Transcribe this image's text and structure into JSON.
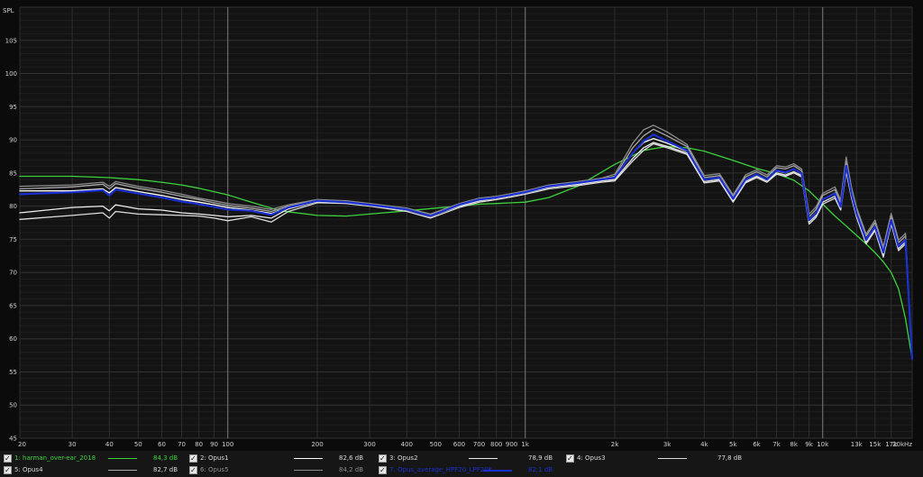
{
  "chart_data": {
    "type": "line",
    "title": "",
    "xlabel": "",
    "ylabel": "SPL",
    "x_scale": "log",
    "xlim": [
      20,
      20000
    ],
    "ylim": [
      45,
      110
    ],
    "grid": true,
    "y_ticks": [
      45,
      50,
      55,
      60,
      65,
      70,
      75,
      80,
      85,
      90,
      95,
      100,
      105
    ],
    "x_ticks": [
      {
        "v": 20,
        "label": "20"
      },
      {
        "v": 30,
        "label": "30"
      },
      {
        "v": 40,
        "label": "40"
      },
      {
        "v": 50,
        "label": "50"
      },
      {
        "v": 60,
        "label": "60"
      },
      {
        "v": 70,
        "label": "70"
      },
      {
        "v": 80,
        "label": "80"
      },
      {
        "v": 90,
        "label": "90"
      },
      {
        "v": 100,
        "label": "100"
      },
      {
        "v": 200,
        "label": "200"
      },
      {
        "v": 300,
        "label": "300"
      },
      {
        "v": 400,
        "label": "400"
      },
      {
        "v": 500,
        "label": "500"
      },
      {
        "v": 600,
        "label": "600"
      },
      {
        "v": 700,
        "label": "700"
      },
      {
        "v": 800,
        "label": "800"
      },
      {
        "v": 900,
        "label": "900"
      },
      {
        "v": 1000,
        "label": "1k"
      },
      {
        "v": 2000,
        "label": "2k"
      },
      {
        "v": 3000,
        "label": "3k"
      },
      {
        "v": 4000,
        "label": "4k"
      },
      {
        "v": 5000,
        "label": "5k"
      },
      {
        "v": 6000,
        "label": "6k"
      },
      {
        "v": 7000,
        "label": "7k"
      },
      {
        "v": 8000,
        "label": "8k"
      },
      {
        "v": 9000,
        "label": "9k"
      },
      {
        "v": 10000,
        "label": "10k"
      },
      {
        "v": 13000,
        "label": "13k"
      },
      {
        "v": 15000,
        "label": "15k"
      },
      {
        "v": 17000,
        "label": "17k"
      },
      {
        "v": 20000,
        "label": "20kHz"
      }
    ],
    "major_x": [
      100,
      1000,
      10000
    ],
    "series": [
      {
        "name": "1: harman_over-ear_2018",
        "color": "#3cd23c",
        "width": 1.3,
        "x": [
          20,
          30,
          40,
          50,
          60,
          70,
          80,
          100,
          120,
          150,
          200,
          250,
          300,
          400,
          500,
          600,
          700,
          800,
          900,
          1000,
          1200,
          1500,
          2000,
          2500,
          3000,
          3500,
          4000,
          5000,
          6000,
          7000,
          8000,
          9000,
          10000,
          11000,
          12000,
          13000,
          14000,
          15000,
          16000,
          17000,
          18000,
          19000,
          20000
        ],
        "y": [
          84.5,
          84.5,
          84.3,
          84.0,
          83.6,
          83.2,
          82.7,
          81.7,
          80.6,
          79.3,
          78.6,
          78.5,
          78.8,
          79.3,
          79.7,
          80.0,
          80.3,
          80.4,
          80.5,
          80.6,
          81.3,
          83.0,
          86.3,
          88.4,
          89.0,
          88.8,
          88.3,
          86.9,
          85.7,
          84.9,
          83.9,
          82.3,
          80.3,
          78.5,
          77.0,
          75.6,
          74.3,
          73.0,
          71.6,
          70.0,
          67.5,
          63.0,
          57.0
        ]
      },
      {
        "name": "2: Opus1",
        "color": "#ffffff",
        "width": 1.3,
        "x": [
          20,
          30,
          38,
          40,
          42,
          50,
          60,
          70,
          80,
          90,
          100,
          120,
          140,
          160,
          200,
          250,
          300,
          400,
          480,
          600,
          700,
          800,
          900,
          1000,
          1200,
          1500,
          1800,
          2000,
          2300,
          2500,
          2700,
          3000,
          3500,
          4000,
          4500,
          5000,
          5500,
          6000,
          6500,
          7000,
          7500,
          8000,
          8500,
          9000,
          9500,
          10000,
          11000,
          11500,
          12000,
          12500,
          13000,
          14000,
          15000,
          16000,
          17000,
          18000,
          19000,
          20000
        ],
        "y": [
          82.3,
          82.3,
          82.6,
          82.0,
          82.8,
          82.2,
          81.6,
          81.0,
          80.6,
          80.2,
          79.8,
          79.4,
          78.9,
          79.8,
          80.7,
          80.6,
          80.2,
          79.5,
          78.4,
          80.2,
          81.0,
          81.3,
          81.7,
          82.1,
          83.0,
          83.5,
          84.0,
          84.3,
          88.0,
          89.6,
          90.2,
          89.5,
          88.3,
          84.0,
          84.2,
          81.0,
          84.0,
          84.8,
          84.0,
          85.3,
          85.0,
          85.6,
          84.8,
          78.0,
          79.0,
          81.0,
          82.0,
          80.0,
          86.0,
          82.0,
          79.0,
          75.0,
          77.0,
          73.0,
          78.0,
          74.0,
          75.0,
          57.0
        ]
      },
      {
        "name": "3: Opus2",
        "color": "#ececec",
        "width": 1.3,
        "x": [
          20,
          30,
          38,
          40,
          42,
          50,
          60,
          70,
          80,
          90,
          100,
          120,
          140,
          160,
          200,
          250,
          300,
          400,
          480,
          600,
          700,
          800,
          900,
          1000,
          1200,
          1500,
          1800,
          2000,
          2300,
          2500,
          2700,
          3000,
          3500,
          4000,
          4500,
          5000,
          5500,
          6000,
          6500,
          7000,
          7500,
          8000,
          8500,
          9000,
          9500,
          10000,
          11000,
          11500,
          12000,
          12500,
          13000,
          14000,
          15000,
          16000,
          17000,
          18000,
          19000,
          20000
        ],
        "y": [
          79.0,
          79.8,
          80.0,
          79.3,
          80.2,
          79.6,
          79.4,
          79.0,
          78.8,
          78.6,
          78.4,
          78.6,
          78.2,
          79.6,
          80.7,
          80.5,
          80.1,
          79.4,
          78.5,
          80.0,
          80.8,
          81.2,
          81.6,
          82.0,
          82.8,
          83.3,
          83.8,
          84.0,
          87.2,
          88.8,
          89.6,
          89.0,
          88.0,
          83.7,
          84.0,
          80.8,
          83.7,
          84.5,
          83.8,
          85.0,
          84.7,
          85.2,
          84.6,
          77.6,
          78.6,
          80.6,
          81.5,
          79.7,
          85.5,
          81.6,
          78.6,
          74.6,
          76.6,
          72.6,
          77.6,
          73.6,
          74.6,
          57.0
        ]
      },
      {
        "name": "4: Opus3",
        "color": "#dcdcdc",
        "width": 1.3,
        "x": [
          20,
          30,
          38,
          40,
          42,
          50,
          60,
          70,
          80,
          90,
          100,
          120,
          140,
          160,
          200,
          250,
          300,
          400,
          480,
          600,
          700,
          800,
          900,
          1000,
          1200,
          1500,
          1800,
          2000,
          2300,
          2500,
          2700,
          3000,
          3500,
          4000,
          4500,
          5000,
          5500,
          6000,
          6500,
          7000,
          7500,
          8000,
          8500,
          9000,
          9500,
          10000,
          11000,
          11500,
          12000,
          12500,
          13000,
          14000,
          15000,
          16000,
          17000,
          18000,
          19000,
          20000
        ],
        "y": [
          78.0,
          78.6,
          79.0,
          78.2,
          79.2,
          78.8,
          78.7,
          78.6,
          78.5,
          78.2,
          77.8,
          78.4,
          77.6,
          79.2,
          80.5,
          80.4,
          80.0,
          79.2,
          78.2,
          79.8,
          80.6,
          81.0,
          81.4,
          81.8,
          82.6,
          83.1,
          83.6,
          83.8,
          86.8,
          88.4,
          89.4,
          88.8,
          87.8,
          83.5,
          83.8,
          80.6,
          83.5,
          84.3,
          83.6,
          84.8,
          84.5,
          85.0,
          84.4,
          77.3,
          78.3,
          80.3,
          81.2,
          79.4,
          85.2,
          81.3,
          78.3,
          74.3,
          76.3,
          72.3,
          77.3,
          73.3,
          74.3,
          57.0
        ]
      },
      {
        "name": "5: Opus4",
        "color": "#a8a8a8",
        "width": 1.3,
        "x": [
          20,
          30,
          38,
          40,
          42,
          50,
          60,
          70,
          80,
          90,
          100,
          120,
          140,
          160,
          200,
          250,
          300,
          400,
          480,
          600,
          700,
          800,
          900,
          1000,
          1200,
          1500,
          1800,
          2000,
          2300,
          2500,
          2700,
          3000,
          3500,
          4000,
          4500,
          5000,
          5500,
          6000,
          6500,
          7000,
          7500,
          8000,
          8500,
          9000,
          9500,
          10000,
          11000,
          11500,
          12000,
          12500,
          13000,
          14000,
          15000,
          16000,
          17000,
          18000,
          19000,
          20000
        ],
        "y": [
          82.6,
          82.9,
          83.3,
          82.6,
          83.4,
          82.7,
          82.1,
          81.5,
          81.0,
          80.5,
          80.1,
          79.7,
          79.2,
          80.0,
          80.9,
          80.7,
          80.3,
          79.6,
          78.6,
          80.3,
          81.1,
          81.4,
          81.8,
          82.2,
          83.1,
          83.6,
          84.1,
          84.5,
          88.8,
          90.6,
          91.6,
          90.6,
          89.0,
          84.3,
          84.6,
          81.4,
          84.4,
          85.2,
          84.4,
          85.8,
          85.6,
          86.1,
          85.3,
          78.4,
          79.5,
          81.6,
          82.5,
          80.5,
          86.8,
          82.5,
          79.5,
          75.5,
          77.5,
          73.6,
          78.5,
          74.5,
          75.5,
          57.0
        ]
      },
      {
        "name": "6: Opus5",
        "color": "#8c8c8c",
        "width": 1.3,
        "x": [
          20,
          30,
          38,
          40,
          42,
          50,
          60,
          70,
          80,
          90,
          100,
          120,
          140,
          160,
          200,
          250,
          300,
          400,
          480,
          600,
          700,
          800,
          900,
          1000,
          1200,
          1500,
          1800,
          2000,
          2300,
          2500,
          2700,
          3000,
          3500,
          4000,
          4500,
          5000,
          5500,
          6000,
          6500,
          7000,
          7500,
          8000,
          8500,
          9000,
          9500,
          10000,
          11000,
          11500,
          12000,
          12500,
          13000,
          14000,
          15000,
          16000,
          17000,
          18000,
          19000,
          20000
        ],
        "y": [
          83.0,
          83.2,
          83.6,
          83.0,
          83.7,
          83.0,
          82.4,
          81.8,
          81.2,
          80.8,
          80.4,
          80.0,
          79.5,
          80.2,
          81.0,
          80.8,
          80.4,
          79.7,
          78.8,
          80.4,
          81.2,
          81.5,
          81.9,
          82.3,
          83.2,
          83.7,
          84.2,
          84.8,
          89.5,
          91.5,
          92.2,
          91.2,
          89.3,
          84.6,
          84.9,
          81.7,
          84.7,
          85.5,
          84.7,
          86.1,
          85.9,
          86.4,
          85.6,
          78.8,
          79.9,
          81.9,
          82.9,
          80.9,
          87.4,
          82.9,
          79.8,
          75.8,
          77.9,
          73.9,
          78.9,
          74.9,
          75.9,
          57.0
        ]
      },
      {
        "name": "7: Opus_average_HPF20_LPF20K",
        "color": "#1a2fd0",
        "width": 2.2,
        "x": [
          20,
          30,
          38,
          40,
          42,
          50,
          60,
          70,
          80,
          90,
          100,
          120,
          140,
          160,
          200,
          250,
          300,
          400,
          480,
          600,
          700,
          800,
          900,
          1000,
          1200,
          1500,
          1800,
          2000,
          2300,
          2500,
          2700,
          3000,
          3500,
          4000,
          4500,
          5000,
          5500,
          6000,
          6500,
          7000,
          7500,
          8000,
          8500,
          9000,
          9500,
          10000,
          11000,
          11500,
          12000,
          12500,
          13000,
          14000,
          15000,
          16000,
          17000,
          18000,
          19000,
          20000
        ],
        "y": [
          81.8,
          82.1,
          82.4,
          81.6,
          82.5,
          81.9,
          81.3,
          80.7,
          80.3,
          79.9,
          79.5,
          79.3,
          78.7,
          79.8,
          80.8,
          80.6,
          80.2,
          79.5,
          78.5,
          80.2,
          81.0,
          81.3,
          81.7,
          82.1,
          83.0,
          83.5,
          84.0,
          84.3,
          88.0,
          89.8,
          90.8,
          89.8,
          88.4,
          84.0,
          84.3,
          81.1,
          84.0,
          84.8,
          84.0,
          85.4,
          85.1,
          85.6,
          84.9,
          77.9,
          78.9,
          81.0,
          81.9,
          79.9,
          86.1,
          81.9,
          78.9,
          74.9,
          76.9,
          73.0,
          77.9,
          73.9,
          74.9,
          57.0
        ]
      }
    ]
  },
  "legend": {
    "items": [
      {
        "label": "1: harman_over-ear_2018",
        "db": "84,3 dB",
        "color": "#3cd23c",
        "label_color": "#3cd23c",
        "db_color": "#3cd23c"
      },
      {
        "label": "2: Opus1",
        "db": "82,6 dB",
        "color": "#ffffff",
        "label_color": "#d8d8d8",
        "db_color": "#d8d8d8"
      },
      {
        "label": "3: Opus2",
        "db": "78,9 dB",
        "color": "#ececec",
        "label_color": "#d8d8d8",
        "db_color": "#d8d8d8"
      },
      {
        "label": "4: Opus3",
        "db": "77,8 dB",
        "color": "#dcdcdc",
        "label_color": "#d8d8d8",
        "db_color": "#d8d8d8"
      },
      {
        "label": "5: Opus4",
        "db": "82,7 dB",
        "color": "#a8a8a8",
        "label_color": "#d8d8d8",
        "db_color": "#d8d8d8"
      },
      {
        "label": "6: Opus5",
        "db": "84,2 dB",
        "color": "#8c8c8c",
        "label_color": "#8c8c8c",
        "db_color": "#8c8c8c"
      },
      {
        "label": "7: Opus_average_HPF20_LPF20K",
        "db": "82,1 dB",
        "color": "#1a2fd0",
        "label_color": "#1a2fd0",
        "db_color": "#1a2fd0"
      }
    ]
  }
}
